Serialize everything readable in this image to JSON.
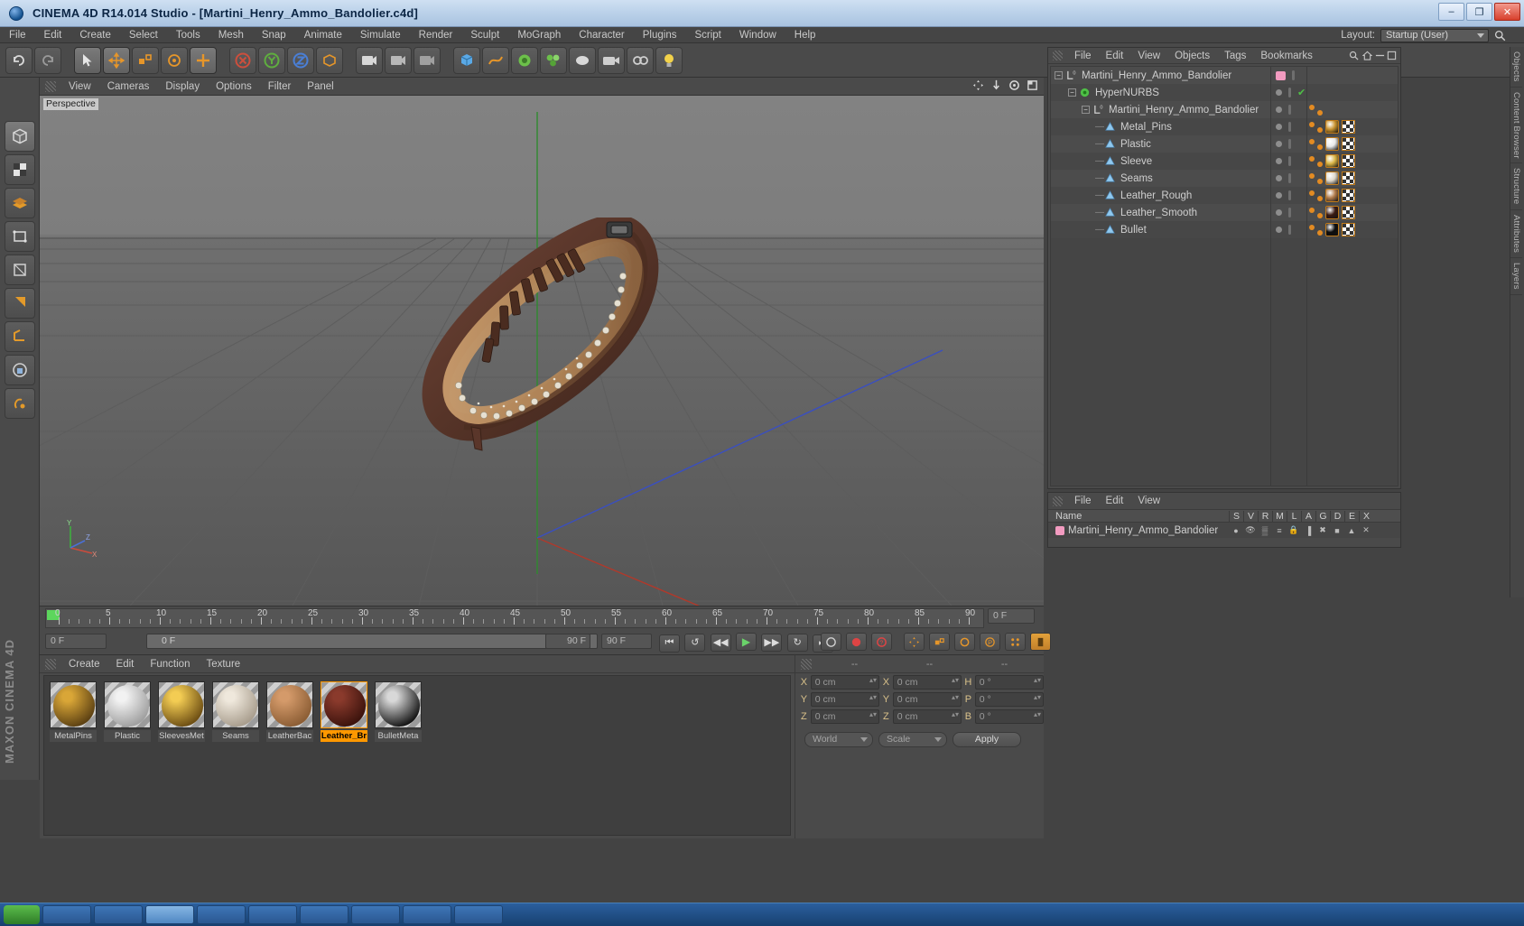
{
  "window": {
    "title": "CINEMA 4D R14.014 Studio - [Martini_Henry_Ammo_Bandolier.c4d]",
    "minimize": "–",
    "maximize": "❐",
    "close": "✕"
  },
  "menubar": {
    "items": [
      "File",
      "Edit",
      "Create",
      "Select",
      "Tools",
      "Mesh",
      "Snap",
      "Animate",
      "Simulate",
      "Render",
      "Sculpt",
      "MoGraph",
      "Character",
      "Plugins",
      "Script",
      "Window",
      "Help"
    ],
    "layout_label": "Layout:",
    "layout_value": "Startup (User)"
  },
  "viewport": {
    "menu": [
      "View",
      "Cameras",
      "Display",
      "Options",
      "Filter",
      "Panel"
    ],
    "perspective_tag": "Perspective",
    "axis_labels": {
      "x": "X",
      "y": "Y",
      "z": "Z"
    },
    "colors": {
      "x_axis": "#c0392b",
      "y_axis": "#2f8a2f",
      "z_axis": "#3b4fc0"
    }
  },
  "timeline": {
    "ticks": [
      0,
      5,
      10,
      15,
      20,
      25,
      30,
      35,
      40,
      45,
      50,
      55,
      60,
      65,
      70,
      75,
      80,
      85,
      90
    ],
    "current_frame_top": "0 F",
    "start_field": "0 F",
    "preview_field": "0 F",
    "end_field_left": "90 F",
    "end_field_right": "90 F",
    "buttons": [
      "⏮",
      "↺",
      "◀◀",
      "▶",
      "▶▶",
      "↻",
      "⏭"
    ]
  },
  "material_manager": {
    "menu": [
      "Create",
      "Edit",
      "Function",
      "Texture"
    ],
    "materials": [
      {
        "name": "MetalPins",
        "color1": "#d9a637",
        "color2": "#5a3f12",
        "selected": false
      },
      {
        "name": "Plastic",
        "color1": "#f2f2f2",
        "color2": "#9e9e9e",
        "selected": false
      },
      {
        "name": "SleevesMet",
        "color1": "#f3cc53",
        "color2": "#6b4c12",
        "selected": false
      },
      {
        "name": "Seams",
        "color1": "#efe8dc",
        "color2": "#a79c8c",
        "selected": false
      },
      {
        "name": "LeatherBac",
        "color1": "#d49a6a",
        "color2": "#8a5c33",
        "selected": false
      },
      {
        "name": "Leather_Br",
        "color1": "#8a3a2c",
        "color2": "#3a120c",
        "selected": true
      },
      {
        "name": "BulletMeta",
        "color1": "#d8d8d8",
        "color2": "#111111",
        "selected": false
      }
    ]
  },
  "coordinates": {
    "header_dashes": [
      "--",
      "--",
      "--"
    ],
    "rows": [
      {
        "pos_label": "X",
        "pos_value": "0 cm",
        "size_label": "X",
        "size_value": "0 cm",
        "rot_label": "H",
        "rot_value": "0 °"
      },
      {
        "pos_label": "Y",
        "pos_value": "0 cm",
        "size_label": "Y",
        "size_value": "0 cm",
        "rot_label": "P",
        "rot_value": "0 °"
      },
      {
        "pos_label": "Z",
        "pos_value": "0 cm",
        "size_label": "Z",
        "size_value": "0 cm",
        "rot_label": "B",
        "rot_value": "0 °"
      }
    ],
    "system_select": "World",
    "mode_select": "Scale",
    "apply_button": "Apply"
  },
  "object_manager": {
    "menu": [
      "File",
      "Edit",
      "View",
      "Objects",
      "Tags",
      "Bookmarks"
    ],
    "items": [
      {
        "label": "Martini_Henry_Ammo_Bandolier",
        "depth": 0,
        "icon": "null-object-icon",
        "has_expander": true,
        "layer_color": "#f29bc0",
        "has_check": false,
        "tags": []
      },
      {
        "label": "HyperNURBS",
        "depth": 1,
        "icon": "hypernurbs-icon",
        "has_expander": true,
        "layer_color": "",
        "has_check": true,
        "tags": []
      },
      {
        "label": "Martini_Henry_Ammo_Bandolier",
        "depth": 2,
        "icon": "null-object-icon",
        "has_expander": true,
        "layer_color": "",
        "has_check": false,
        "tags": [
          "dots"
        ]
      },
      {
        "label": "Metal_Pins",
        "depth": 3,
        "icon": "polygon-object-icon",
        "has_expander": false,
        "layer_color": "",
        "has_check": false,
        "tags": [
          "dots",
          "material",
          "uv"
        ]
      },
      {
        "label": "Plastic",
        "depth": 3,
        "icon": "polygon-object-icon",
        "has_expander": false,
        "layer_color": "",
        "has_check": false,
        "tags": [
          "dots",
          "material",
          "uv"
        ]
      },
      {
        "label": "Sleeve",
        "depth": 3,
        "icon": "polygon-object-icon",
        "has_expander": false,
        "layer_color": "",
        "has_check": false,
        "tags": [
          "dots",
          "material",
          "uv"
        ]
      },
      {
        "label": "Seams",
        "depth": 3,
        "icon": "polygon-object-icon",
        "has_expander": false,
        "layer_color": "",
        "has_check": false,
        "tags": [
          "dots",
          "material",
          "uv"
        ]
      },
      {
        "label": "Leather_Rough",
        "depth": 3,
        "icon": "polygon-object-icon",
        "has_expander": false,
        "layer_color": "",
        "has_check": false,
        "tags": [
          "dots",
          "material",
          "uv"
        ]
      },
      {
        "label": "Leather_Smooth",
        "depth": 3,
        "icon": "polygon-object-icon",
        "has_expander": false,
        "layer_color": "",
        "has_check": false,
        "tags": [
          "dots",
          "material",
          "uv"
        ]
      },
      {
        "label": "Bullet",
        "depth": 3,
        "icon": "polygon-object-icon",
        "has_expander": false,
        "layer_color": "",
        "has_check": false,
        "tags": [
          "dots",
          "material",
          "uv"
        ]
      }
    ],
    "material_swatch_colors": [
      "#c8922f",
      "#e8e8e8",
      "#d9b545",
      "#ddd6c8",
      "#b07a4a",
      "#3b1b12",
      "#0d0d0d"
    ]
  },
  "layer_manager": {
    "menu": [
      "File",
      "Edit",
      "View"
    ],
    "name_header": "Name",
    "column_headers": [
      "S",
      "V",
      "R",
      "M",
      "L",
      "A",
      "G",
      "D",
      "E",
      "X"
    ],
    "rows": [
      {
        "name": "Martini_Henry_Ammo_Bandolier",
        "color": "#f29bc0"
      }
    ]
  },
  "right_dock_tabs": [
    "Objects",
    "Content Browser",
    "Structure",
    "Attributes",
    "Layers"
  ]
}
